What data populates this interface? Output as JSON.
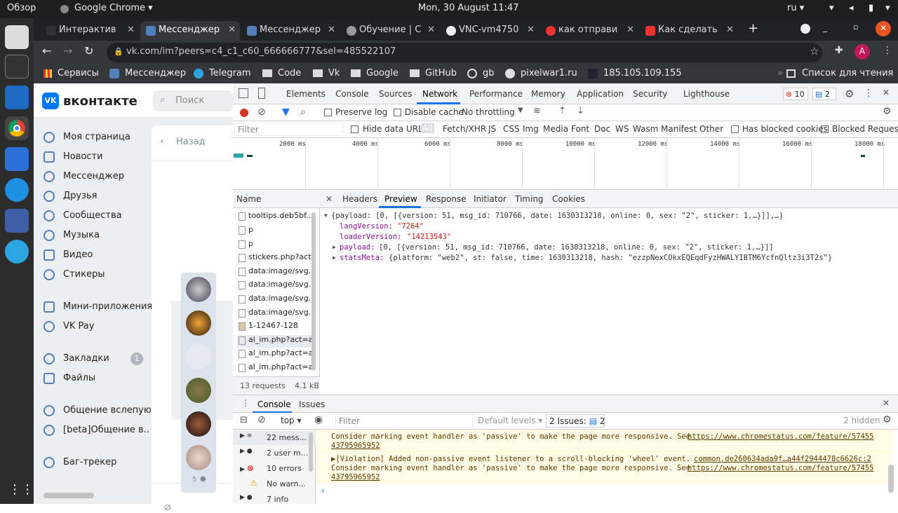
{
  "os": {
    "activities": "Обзор",
    "app_menu": "Google Chrome ▾",
    "clock": "Mon, 30 August  11:47",
    "lang": "ru ▾"
  },
  "tabs": [
    {
      "label": "Интерактив",
      "color": "#333"
    },
    {
      "label": "Мессенджер",
      "color": "#5181b8"
    },
    {
      "label": "Мессенджер",
      "color": "#5181b8"
    },
    {
      "label": "Обучение | С",
      "color": "#666"
    },
    {
      "label": "VNC-vm4750",
      "color": "#444"
    },
    {
      "label": "как отправи",
      "color": "#d33"
    },
    {
      "label": "Как сделать",
      "color": "#d33"
    }
  ],
  "new_tab": "+",
  "url": "vk.com/im?peers=c4_c1_c60_666666777&sel=485522107",
  "bookmarks": [
    "Сервисы",
    "Мессенджер",
    "Telegram",
    "Code",
    "Vk",
    "Google",
    "GitHub",
    "gb",
    "pixelwar1.ru",
    "185.105.109.155"
  ],
  "reading_list": "Список для чтения",
  "vk": {
    "logo": "вконтакте",
    "search_placeholder": "Поиск",
    "back": "Назад",
    "nav": [
      "Моя страница",
      "Новости",
      "Мессенджер",
      "Друзья",
      "Сообщества",
      "Музыка",
      "Видео",
      "Стикеры"
    ],
    "nav2": [
      "Мини-приложения",
      "VK Pay"
    ],
    "nav3": [
      "Закладки",
      "Файлы"
    ],
    "bookmarks_count": "1",
    "nav4": [
      "Общение вслепую..",
      "[beta]Общение в.."
    ],
    "nav5": [
      "Баг-трекер"
    ],
    "members": "5"
  },
  "devtools": {
    "tabs": [
      "Elements",
      "Console",
      "Sources",
      "Network",
      "Performance",
      "Memory",
      "Application",
      "Security",
      "Lighthouse"
    ],
    "errors": "10",
    "issues": "2",
    "preserve_log": "Preserve log",
    "disable_cache": "Disable cache",
    "throttling": "No throttling",
    "filter_placeholder": "Filter",
    "hide_data_urls": "Hide data URLs",
    "all": "All",
    "types": [
      "Fetch/XHR",
      "JS",
      "CSS",
      "Img",
      "Media",
      "Font",
      "Doc",
      "WS",
      "Wasm",
      "Manifest",
      "Other"
    ],
    "blocked_cookies": "Has blocked cookies",
    "blocked_requests": "Blocked Requests",
    "timeline": [
      "2000 ms",
      "4000 ms",
      "6000 ms",
      "8000 ms",
      "10000 ms",
      "12000 ms",
      "14000 ms",
      "16000 ms",
      "18000 ms"
    ],
    "name_header": "Name",
    "requests": [
      "tooltips.deb5bf...",
      "p",
      "p",
      "stickers.php?act...",
      "data:image/svg...",
      "data:image/svg...",
      "data:image/svg...",
      "data:image/svg...",
      "1-12467-128",
      "al_im.php?act=a...",
      "al_im.php?act=a...",
      "al_im.php?act=a..."
    ],
    "summary": "13 requests",
    "size": "4.1 kB",
    "detail_tabs": [
      "Headers",
      "Preview",
      "Response",
      "Initiator",
      "Timing",
      "Cookies"
    ],
    "preview": {
      "root": "{payload: [0, [{version: 51, msg_id: 710766, date: 1630313218, online: 0, sex: \"2\", sticker: 1,…}]],…}",
      "langVersion_key": "langVersion:",
      "langVersion_val": "\"7264\"",
      "loaderVersion_key": "loaderVersion:",
      "loaderVersion_val": "\"14213543\"",
      "payload_key": "payload:",
      "payload_val": "[0, [{version: 51, msg_id: 710766, date: 1630313218, online: 0, sex: \"2\", sticker: 1,…}]]",
      "statsMeta_key": "statsMeta:",
      "statsMeta_val": "{platform: \"web2\", st: false, time: 1630313218, hash: \"ezzpNexCOkxEQEqdFyzHWALYIBTM6YcfnQltz3i3T2s\"}"
    },
    "drawer_tabs": [
      "Console",
      "Issues"
    ],
    "context": "top ▾",
    "console_filter": "Filter",
    "levels": "Default levels ▾",
    "issues_btn": "2 Issues:",
    "issues_count": "2",
    "hidden": "2 hidden",
    "sidebar": [
      "22 mess...",
      "2 user m...",
      "10 errors",
      "No warn...",
      "7 info"
    ],
    "msg1a": "Consider marking event handler as 'passive' to make the page more responsive. See ",
    "link1": "https://www.chromestatus.com/feature/57455",
    "link1b": "43795965952",
    "msg2": "▶[Violation] Added non-passive event listener to a scroll-blocking 'wheel' event.",
    "src2": "common.de260634ada9f…a44f2944478c6626c:2",
    "msg2b": "Consider marking event handler as 'passive' to make the page more responsive. See ",
    "link2": "https://www.chromestatus.com/feature/57455",
    "link2b": "43795965952"
  }
}
